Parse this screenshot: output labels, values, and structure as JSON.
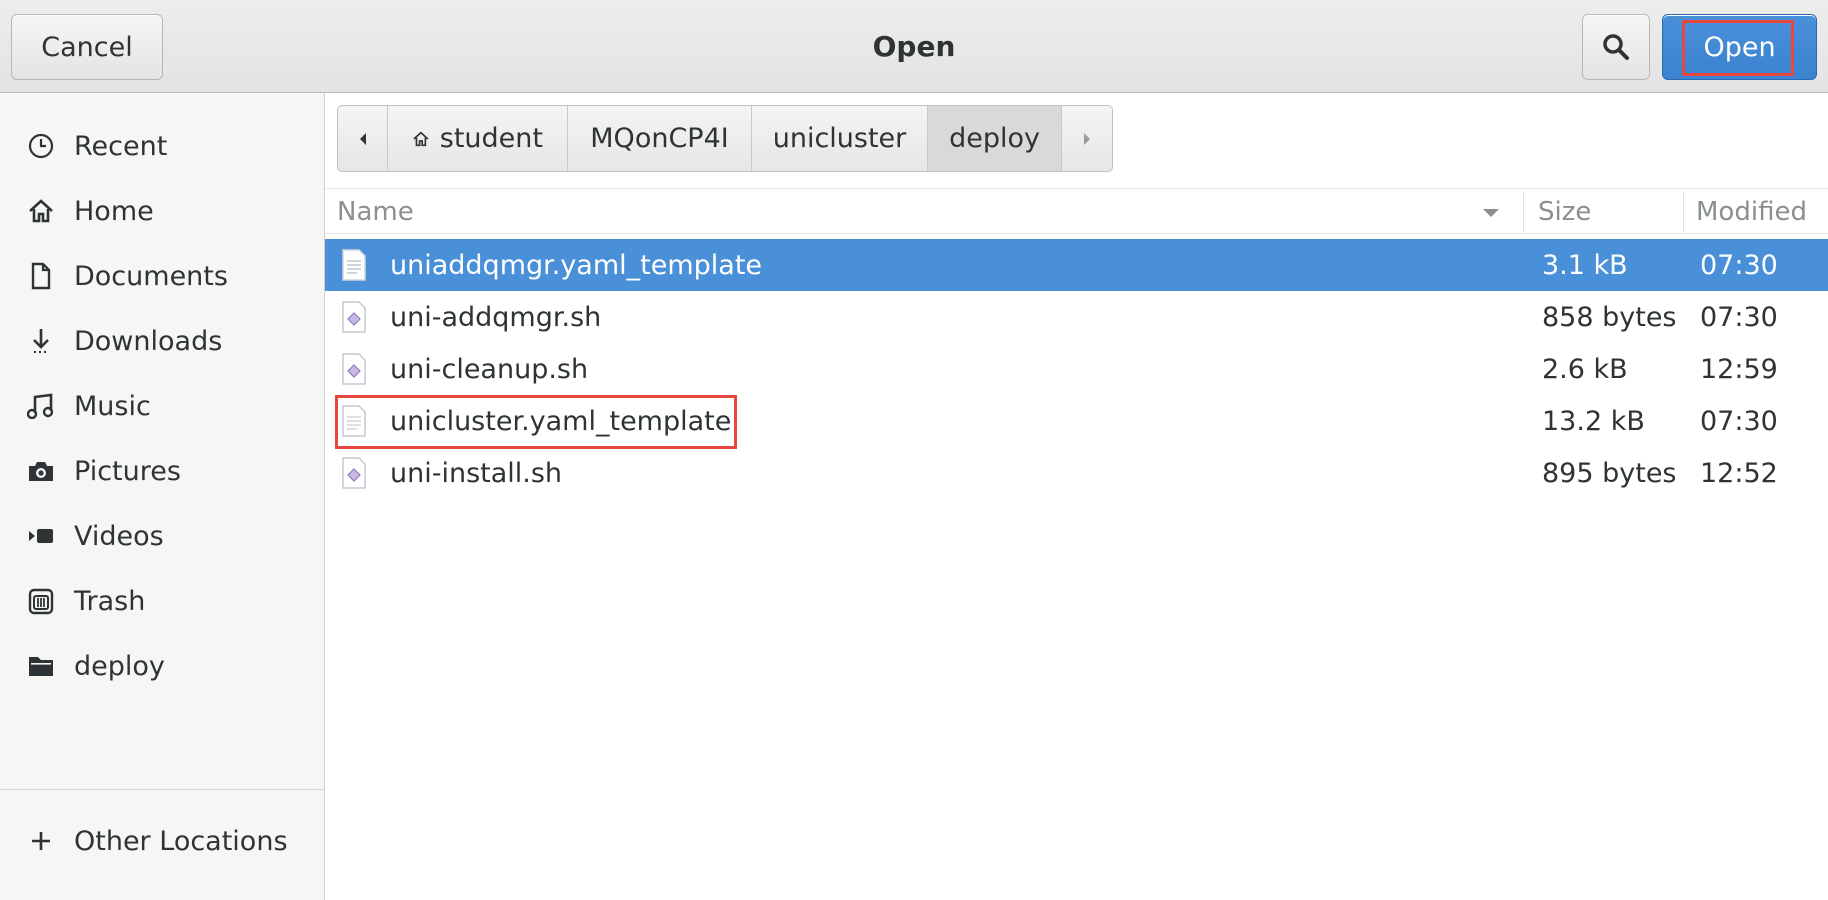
{
  "header": {
    "title": "Open",
    "cancel_label": "Cancel",
    "open_label": "Open",
    "search_icon": "search-icon"
  },
  "sidebar": {
    "items": [
      {
        "label": "Recent",
        "icon": "clock-icon"
      },
      {
        "label": "Home",
        "icon": "home-icon"
      },
      {
        "label": "Documents",
        "icon": "document-icon"
      },
      {
        "label": "Downloads",
        "icon": "download-icon"
      },
      {
        "label": "Music",
        "icon": "music-icon"
      },
      {
        "label": "Pictures",
        "icon": "camera-icon"
      },
      {
        "label": "Videos",
        "icon": "video-icon"
      },
      {
        "label": "Trash",
        "icon": "trash-icon"
      },
      {
        "label": "deploy",
        "icon": "folder-icon"
      }
    ],
    "other_locations": {
      "label": "Other Locations",
      "icon": "plus-icon"
    }
  },
  "pathbar": {
    "segments": [
      "student",
      "MQonCP4I",
      "unicluster",
      "deploy"
    ],
    "active": "deploy"
  },
  "columns": {
    "name": "Name",
    "size": "Size",
    "modified": "Modified"
  },
  "files": [
    {
      "name": "uniaddqmgr.yaml_template",
      "size": "3.1 kB",
      "modified": "07:30",
      "type": "text",
      "selected": true
    },
    {
      "name": "uni-addqmgr.sh",
      "size": "858 bytes",
      "modified": "07:30",
      "type": "script",
      "selected": false
    },
    {
      "name": "uni-cleanup.sh",
      "size": "2.6 kB",
      "modified": "12:59",
      "type": "script",
      "selected": false
    },
    {
      "name": "unicluster.yaml_template",
      "size": "13.2 kB",
      "modified": "07:30",
      "type": "text",
      "selected": false
    },
    {
      "name": "uni-install.sh",
      "size": "895 bytes",
      "modified": "12:52",
      "type": "script",
      "selected": false
    }
  ],
  "colors": {
    "accent": "#4a90d9",
    "highlight": "#e8473d"
  }
}
